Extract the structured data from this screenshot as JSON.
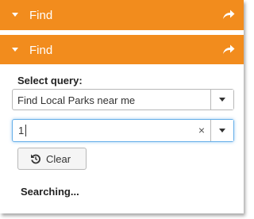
{
  "colors": {
    "header_bg": "#f28c1d",
    "header_text": "#ffffff",
    "focus_border": "#66afe9"
  },
  "header_back": {
    "title": "Find",
    "icon": "share-icon"
  },
  "header_front": {
    "title": "Find",
    "icon": "share-icon"
  },
  "query": {
    "label": "Select query:",
    "selected": "Find Local Parks near me"
  },
  "search": {
    "value": "1",
    "clear_glyph": "×"
  },
  "clear_button": {
    "label": "Clear",
    "icon": "undo-icon"
  },
  "status": {
    "text": "Searching..."
  }
}
